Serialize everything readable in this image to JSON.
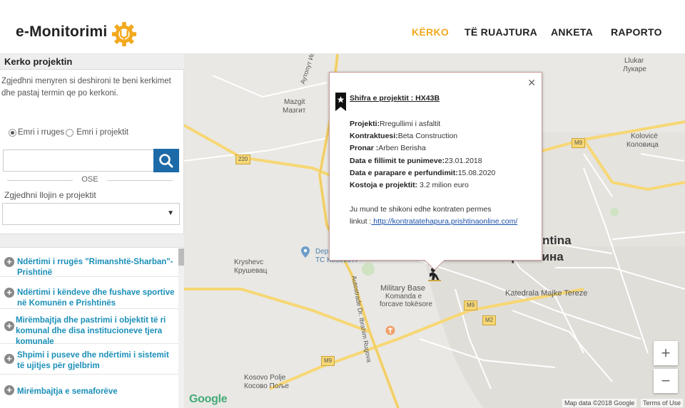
{
  "header": {
    "logo_text": "e-Monitorimi",
    "nav": [
      {
        "label": "KËRKO",
        "active": true
      },
      {
        "label": "TË RUAJTURA",
        "active": false
      },
      {
        "label": "ANKETA",
        "active": false
      },
      {
        "label": "RAPORTO",
        "active": false
      }
    ],
    "accent_color": "#f2a91f"
  },
  "sidebar": {
    "title": "Kerko projektin",
    "description": "Zgjedhni menyren si deshironi te beni kerkimet dhe pastaj termin qe po kerkoni.",
    "radio_street": "Emri i rruges",
    "radio_project": "Emri i projektit",
    "search_value": "",
    "separator": "OSE",
    "type_label": "Zgjedhni llojin e projektit",
    "type_selected": "",
    "items": [
      {
        "label": "Ndërtimi i rrugës \"Rimanshtë-Sharban\"-Prishtinë"
      },
      {
        "label": "Ndërtimi i këndeve dhe fushave sportive në Komunën e Prishtinës"
      },
      {
        "label": "Mirëmbajtja dhe pastrimi i objektit të ri komunal dhe disa institucioneve tjera komunale"
      },
      {
        "label": "Shpimi i puseve dhe ndërtimi i sistemit të ujitjes për gjelbrim"
      },
      {
        "label": "Mirëmbajtja e semaforëve"
      }
    ]
  },
  "popup": {
    "title": "Shifra e projektit : HX43B",
    "project_label": "Projekti:",
    "project_value": "Rregullimi i asfaltit",
    "contractor_label": "Kontraktuesi:",
    "contractor_value": "Beta Construction",
    "owner_label": "Pronar :",
    "owner_value": "Arben Berisha",
    "start_label": "Data e fillimit te punimeve:",
    "start_value": "23.01.2018",
    "end_label": "Data e parapare e perfundimit:",
    "end_value": "15.08.2020",
    "cost_label": "Kostoja e projektit:",
    "cost_value": " 3.2 milion euro",
    "note_line1": "Ju mund te shikoni edhe kontraten permes",
    "note_line2": "linkut :",
    "link": " http://kontratatehapura.prishtinaonline.com/"
  },
  "map": {
    "labels": {
      "llukar": "Llukar",
      "llukar_cyr": "Лукаре",
      "mazgit": "Mazgit",
      "mazgit_cyr": "Мазгит",
      "kolovice": "Kolovicë",
      "kolovice_cyr": "Коловица",
      "kryshevc": "Kryshevc",
      "kryshevc_cyr": "Крушевац",
      "dep": "Dep",
      "tc": "TC Kosova A",
      "military": "Military Base",
      "komanda": "Komanda e",
      "forcave": "forcave tokësore",
      "prishtina_cyr": "Приштина",
      "prishtina_part": "ntina",
      "katedrala": "Katedrala Majke Tereze",
      "kosovo_polje": "Kosovo Polje",
      "kosovo_polje_cyr": "Косово Поље",
      "autoput": "Аутопут Ибрахим Ругова",
      "autostrade": "Autostrade Dr. Ibrahim Rugova",
      "road_220": "220",
      "road_m9": "M9",
      "road_m2": "M2"
    },
    "google": "Google",
    "attribution": "Map data ©2018 Google",
    "terms": "Terms of Use",
    "zoom_in": "+",
    "zoom_out": "−"
  }
}
